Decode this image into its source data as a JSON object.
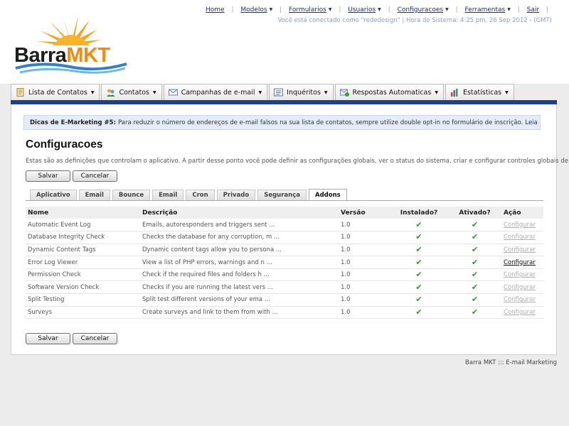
{
  "brand": {
    "part1": "Barra",
    "part2": "MKT"
  },
  "topnav": {
    "items": [
      {
        "label": "Home",
        "dropdown": false
      },
      {
        "label": "Modelos",
        "dropdown": true
      },
      {
        "label": "Formularios",
        "dropdown": true
      },
      {
        "label": "Usuarios",
        "dropdown": true
      },
      {
        "label": "Configuracoes",
        "dropdown": true
      },
      {
        "label": "Ferramentas",
        "dropdown": true
      },
      {
        "label": "Sair",
        "dropdown": false
      }
    ],
    "status": "Você está conectado como \"rededesign\" | Hora do Sistema: 4:25 pm, 26 Sep 2012 - (GMT)"
  },
  "main_tabs": [
    {
      "label": "Lista de Contatos",
      "icon": "contact-list-icon"
    },
    {
      "label": "Contatos",
      "icon": "contacts-icon"
    },
    {
      "label": "Campanhas de e-mail",
      "icon": "email-campaign-icon"
    },
    {
      "label": "Inquéritos",
      "icon": "survey-icon"
    },
    {
      "label": "Respostas Automaticas",
      "icon": "autoresponder-icon"
    },
    {
      "label": "Estatísticas",
      "icon": "stats-icon"
    }
  ],
  "tip": {
    "title": "Dicas de E-Marketing #5:",
    "text": "Para reduzir o número de endereços de e-mail falsos na sua lista de contatos, sempre utilize double opt-in no formulário de inscrição.",
    "link": "Leia mais…"
  },
  "page": {
    "title": "Configuracoes",
    "description": "Estas são as definições que controlam o aplicativo. A partir desse ponto você pode definir as configurações globais, ver o status do sistema, criar e configurar controles globais de e-mail.",
    "save_label": "Salvar",
    "cancel_label": "Cancelar"
  },
  "settings_tabs": [
    "Aplicativo",
    "Email",
    "Bounce",
    "Email",
    "Cron",
    "Privado",
    "Segurança",
    "Addons"
  ],
  "active_tab": "Addons",
  "table": {
    "headers": {
      "name": "Nome",
      "description": "Descrição",
      "version": "Versão",
      "installed": "Instalado?",
      "enabled": "Ativado?",
      "action": "Ação"
    },
    "rows": [
      {
        "name": "Automatic Event Log",
        "description": "Emails, autoresponders and triggers sent ...",
        "version": "1.0",
        "installed": true,
        "enabled": true,
        "action": "Configurar",
        "action_enabled": false
      },
      {
        "name": "Database Integrity Check",
        "description": "Checks the database for any corruption, m ...",
        "version": "1.0",
        "installed": true,
        "enabled": true,
        "action": "Configurar",
        "action_enabled": false
      },
      {
        "name": "Dynamic Content Tags",
        "description": "Dynamic content tags allow you to persona ...",
        "version": "1.0",
        "installed": true,
        "enabled": true,
        "action": "Configurar",
        "action_enabled": false
      },
      {
        "name": "Error Log Viewer",
        "description": "View a list of PHP errors, warnings and n ...",
        "version": "1.0",
        "installed": true,
        "enabled": true,
        "action": "Configurar",
        "action_enabled": true
      },
      {
        "name": "Permission Check",
        "description": "Check if the required files and folders h ...",
        "version": "1.0",
        "installed": true,
        "enabled": true,
        "action": "Configurar",
        "action_enabled": false
      },
      {
        "name": "Software Version Check",
        "description": "Checks if you are running the latest vers ...",
        "version": "1.0",
        "installed": true,
        "enabled": true,
        "action": "Configurar",
        "action_enabled": false
      },
      {
        "name": "Split Testing",
        "description": "Split test different versions of your ema ...",
        "version": "1.0",
        "installed": true,
        "enabled": true,
        "action": "Configurar",
        "action_enabled": false
      },
      {
        "name": "Surveys",
        "description": "Create surveys and link to them from with ...",
        "version": "1.0",
        "installed": true,
        "enabled": true,
        "action": "Configurar",
        "action_enabled": false
      }
    ]
  },
  "footer": "Barra MKT ::: E-mail Marketing",
  "colors": {
    "accent_blue": "#1f3e8c",
    "link": "#1a2d8c",
    "check_green": "#2e9a2e",
    "logo_orange": "#f08a10"
  }
}
